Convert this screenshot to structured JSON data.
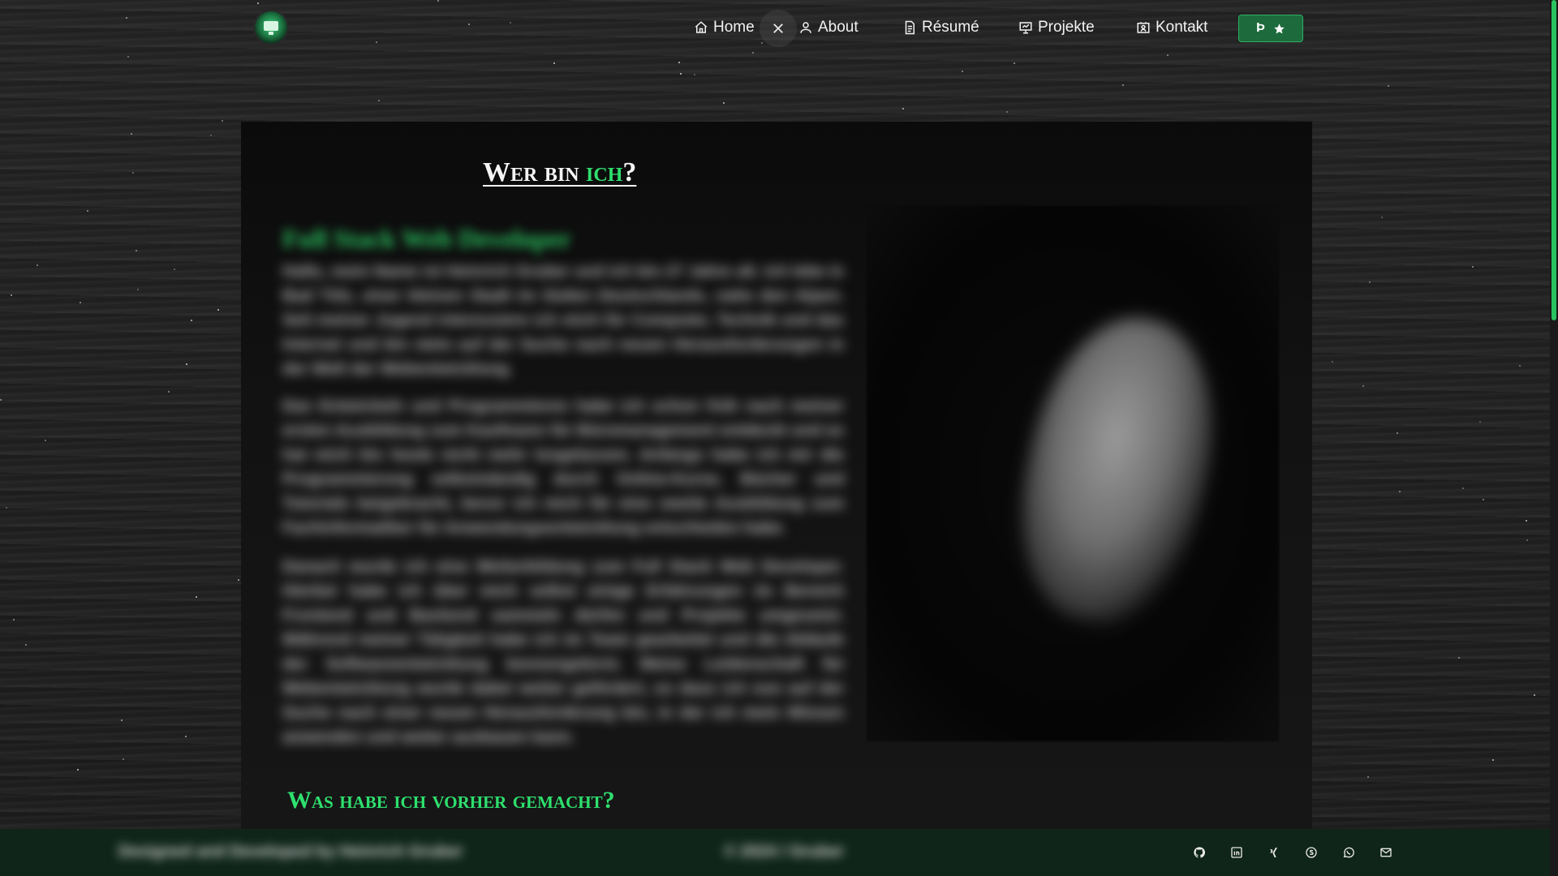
{
  "nav": {
    "items": [
      {
        "label": "Home",
        "icon": "home-icon"
      },
      {
        "label": "About",
        "icon": "user-icon"
      },
      {
        "label": "Résumé",
        "icon": "document-icon"
      },
      {
        "label": "Projekte",
        "icon": "presentation-icon"
      },
      {
        "label": "Kontakt",
        "icon": "contact-card-icon"
      }
    ],
    "cta_label": "Þ"
  },
  "hero": {
    "title_main": "Wer bin ",
    "title_accent": "ich",
    "title_end": "?",
    "subtitle": "Full Stack Web Developer",
    "paragraphs": [
      "Hallo, mein Name ist Heinrich Gruber und ich bin 27 Jahre alt. Ich lebe in Bad Tölz, einer kleinen Stadt im Süden Deutschlands, nahe den Alpen. Seit meiner Jugend interessiere ich mich für Computer, Technik und das Internet und bin stets auf der Suche nach neuen Herausforderungen in der Welt der Webentwicklung.",
      "Das Entwickeln und Programmieren habe ich schon früh nach meiner ersten Ausbildung zum Kaufmann für Büromanagement entdeckt und es hat mich bis heute nicht mehr losgelassen. Anfangs habe ich mir die Programmierung selbstständig durch Online-Kurse, Bücher und Tutorials beigebracht, bevor ich mich für eine zweite Ausbildung zum Fachinformatiker für Anwendungsentwicklung entschieden habe.",
      "Danach wurde ich eine Weiterbildung zum Full Stack Web Developer. Hierbei habe ich über mich selbst einige Erfahrungen im Bereich Frontend und Backend sammeln dürfen und Projekte umgesetzt. Während meiner Tätigkeit habe ich im Team gearbeitet und die Abläufe der Softwareentwicklung kennengelernt. Meine Leidenschaft für Webentwicklung wurde dabei weiter gefördert, so dass ich nun auf der Suche nach einer neuen Herausforderung bin, in der ich mein Wissen anwenden und weiter ausbauen kann."
    ],
    "highlight_name": "Heinrich Gruber",
    "highlight_age": "27 Jahre",
    "section2_title": "Was habe ich vorher gemacht?"
  },
  "footer": {
    "left_text": "Designed and Developed by Heinrich Gruber",
    "middle_text": "© 2024 / Gruber",
    "social": [
      "github-icon",
      "linkedin-icon",
      "xing-icon",
      "skype-icon",
      "whatsapp-icon",
      "mail-icon"
    ]
  },
  "colors": {
    "accent": "#2ee06e",
    "footer_bg": "#0f2519",
    "cta_bg": "#1d6b3d"
  }
}
